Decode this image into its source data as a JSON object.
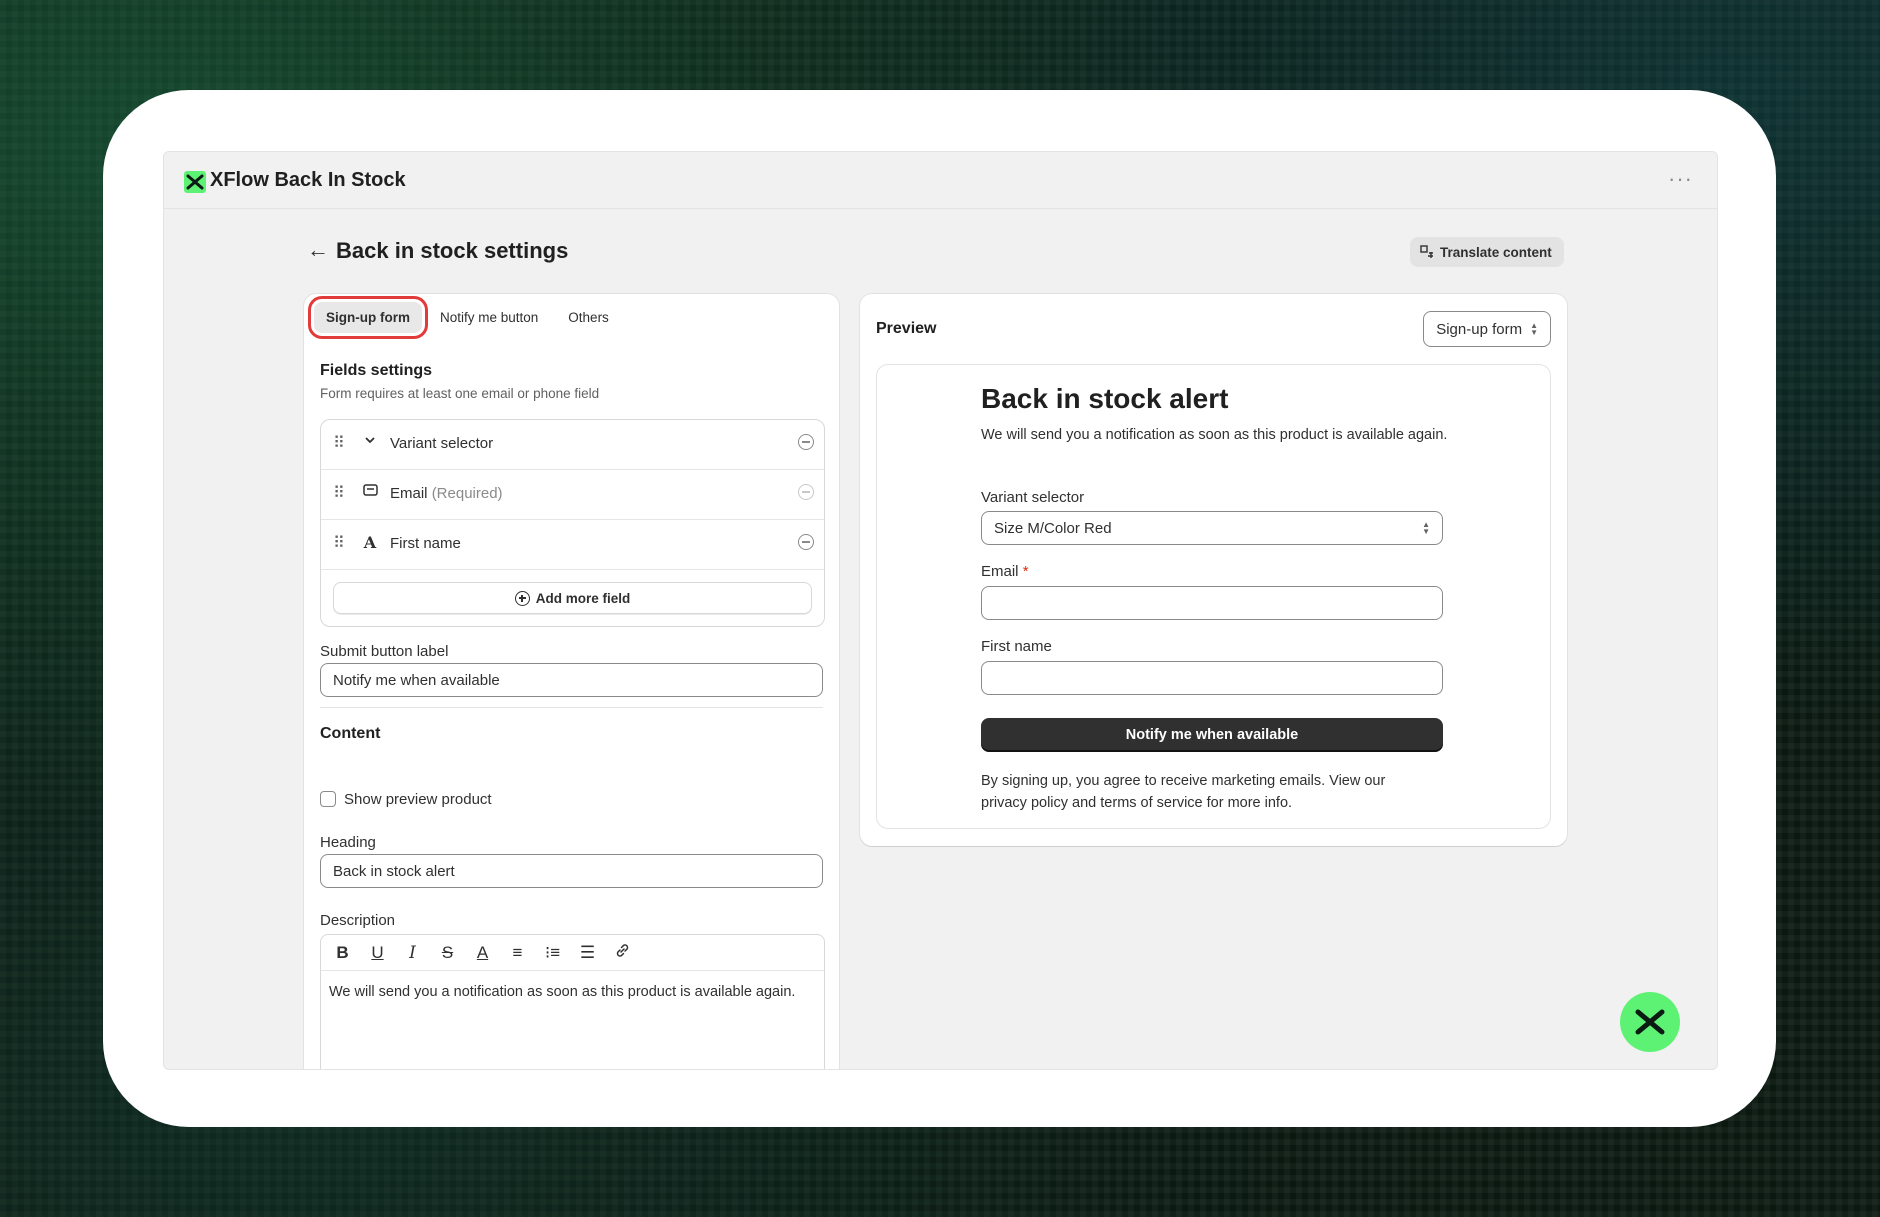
{
  "app": {
    "title": "XFlow Back In Stock",
    "more_icon": "ellipsis-icon",
    "brand_color": "#5ef274"
  },
  "header": {
    "title": "Back in stock settings",
    "translate_label": "Translate content"
  },
  "tabs": [
    {
      "label": "Sign-up form",
      "active": true
    },
    {
      "label": "Notify me button",
      "active": false
    },
    {
      "label": "Others",
      "active": false
    }
  ],
  "fields_settings": {
    "title": "Fields settings",
    "subtitle": "Form requires at least one email or phone field",
    "fields": [
      {
        "label": "Variant selector",
        "suffix": "",
        "icon": "chevron-down-icon",
        "removable": true
      },
      {
        "label": "Email",
        "suffix": "(Required)",
        "icon": "envelope-icon",
        "removable": false
      },
      {
        "label": "First name",
        "suffix": "",
        "icon": "text-a-icon",
        "removable": true
      }
    ],
    "add_label": "Add more field"
  },
  "submit": {
    "label": "Submit button label",
    "value": "Notify me when available"
  },
  "content": {
    "title": "Content",
    "show_preview_label": "Show preview product",
    "show_preview_checked": false,
    "heading_label": "Heading",
    "heading_value": "Back in stock alert",
    "description_label": "Description",
    "description_value": "We will send you a notification as soon as this product is available again."
  },
  "preview": {
    "title": "Preview",
    "select_value": "Sign-up form",
    "heading": "Back in stock alert",
    "description": "We will send you a notification as soon as this product is available again.",
    "variant_label": "Variant selector",
    "variant_value": "Size M/Color Red",
    "email_label": "Email",
    "email_required_mark": "*",
    "first_name_label": "First name",
    "button_label": "Notify me when available",
    "legal": "By signing up, you agree to receive marketing emails. View our privacy policy and terms of service for more info."
  }
}
